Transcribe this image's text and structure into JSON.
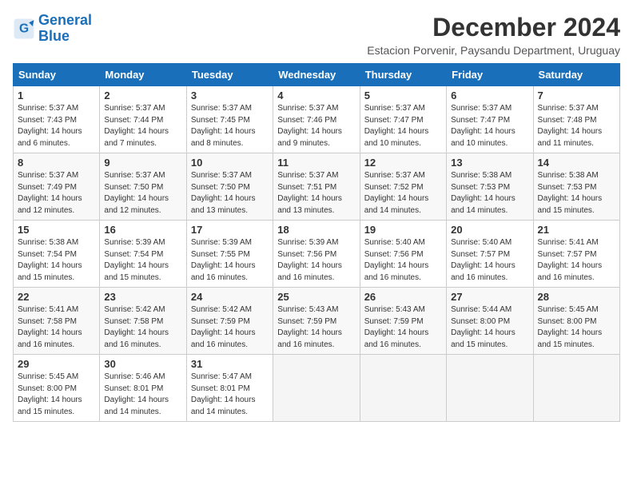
{
  "header": {
    "logo_line1": "General",
    "logo_line2": "Blue",
    "month": "December 2024",
    "location": "Estacion Porvenir, Paysandu Department, Uruguay"
  },
  "weekdays": [
    "Sunday",
    "Monday",
    "Tuesday",
    "Wednesday",
    "Thursday",
    "Friday",
    "Saturday"
  ],
  "weeks": [
    [
      {
        "day": "1",
        "sunrise": "5:37 AM",
        "sunset": "7:43 PM",
        "daylight": "14 hours and 6 minutes."
      },
      {
        "day": "2",
        "sunrise": "5:37 AM",
        "sunset": "7:44 PM",
        "daylight": "14 hours and 7 minutes."
      },
      {
        "day": "3",
        "sunrise": "5:37 AM",
        "sunset": "7:45 PM",
        "daylight": "14 hours and 8 minutes."
      },
      {
        "day": "4",
        "sunrise": "5:37 AM",
        "sunset": "7:46 PM",
        "daylight": "14 hours and 9 minutes."
      },
      {
        "day": "5",
        "sunrise": "5:37 AM",
        "sunset": "7:47 PM",
        "daylight": "14 hours and 10 minutes."
      },
      {
        "day": "6",
        "sunrise": "5:37 AM",
        "sunset": "7:47 PM",
        "daylight": "14 hours and 10 minutes."
      },
      {
        "day": "7",
        "sunrise": "5:37 AM",
        "sunset": "7:48 PM",
        "daylight": "14 hours and 11 minutes."
      }
    ],
    [
      {
        "day": "8",
        "sunrise": "5:37 AM",
        "sunset": "7:49 PM",
        "daylight": "14 hours and 12 minutes."
      },
      {
        "day": "9",
        "sunrise": "5:37 AM",
        "sunset": "7:50 PM",
        "daylight": "14 hours and 12 minutes."
      },
      {
        "day": "10",
        "sunrise": "5:37 AM",
        "sunset": "7:50 PM",
        "daylight": "14 hours and 13 minutes."
      },
      {
        "day": "11",
        "sunrise": "5:37 AM",
        "sunset": "7:51 PM",
        "daylight": "14 hours and 13 minutes."
      },
      {
        "day": "12",
        "sunrise": "5:37 AM",
        "sunset": "7:52 PM",
        "daylight": "14 hours and 14 minutes."
      },
      {
        "day": "13",
        "sunrise": "5:38 AM",
        "sunset": "7:53 PM",
        "daylight": "14 hours and 14 minutes."
      },
      {
        "day": "14",
        "sunrise": "5:38 AM",
        "sunset": "7:53 PM",
        "daylight": "14 hours and 15 minutes."
      }
    ],
    [
      {
        "day": "15",
        "sunrise": "5:38 AM",
        "sunset": "7:54 PM",
        "daylight": "14 hours and 15 minutes."
      },
      {
        "day": "16",
        "sunrise": "5:39 AM",
        "sunset": "7:54 PM",
        "daylight": "14 hours and 15 minutes."
      },
      {
        "day": "17",
        "sunrise": "5:39 AM",
        "sunset": "7:55 PM",
        "daylight": "14 hours and 16 minutes."
      },
      {
        "day": "18",
        "sunrise": "5:39 AM",
        "sunset": "7:56 PM",
        "daylight": "14 hours and 16 minutes."
      },
      {
        "day": "19",
        "sunrise": "5:40 AM",
        "sunset": "7:56 PM",
        "daylight": "14 hours and 16 minutes."
      },
      {
        "day": "20",
        "sunrise": "5:40 AM",
        "sunset": "7:57 PM",
        "daylight": "14 hours and 16 minutes."
      },
      {
        "day": "21",
        "sunrise": "5:41 AM",
        "sunset": "7:57 PM",
        "daylight": "14 hours and 16 minutes."
      }
    ],
    [
      {
        "day": "22",
        "sunrise": "5:41 AM",
        "sunset": "7:58 PM",
        "daylight": "14 hours and 16 minutes."
      },
      {
        "day": "23",
        "sunrise": "5:42 AM",
        "sunset": "7:58 PM",
        "daylight": "14 hours and 16 minutes."
      },
      {
        "day": "24",
        "sunrise": "5:42 AM",
        "sunset": "7:59 PM",
        "daylight": "14 hours and 16 minutes."
      },
      {
        "day": "25",
        "sunrise": "5:43 AM",
        "sunset": "7:59 PM",
        "daylight": "14 hours and 16 minutes."
      },
      {
        "day": "26",
        "sunrise": "5:43 AM",
        "sunset": "7:59 PM",
        "daylight": "14 hours and 16 minutes."
      },
      {
        "day": "27",
        "sunrise": "5:44 AM",
        "sunset": "8:00 PM",
        "daylight": "14 hours and 15 minutes."
      },
      {
        "day": "28",
        "sunrise": "5:45 AM",
        "sunset": "8:00 PM",
        "daylight": "14 hours and 15 minutes."
      }
    ],
    [
      {
        "day": "29",
        "sunrise": "5:45 AM",
        "sunset": "8:00 PM",
        "daylight": "14 hours and 15 minutes."
      },
      {
        "day": "30",
        "sunrise": "5:46 AM",
        "sunset": "8:01 PM",
        "daylight": "14 hours and 14 minutes."
      },
      {
        "day": "31",
        "sunrise": "5:47 AM",
        "sunset": "8:01 PM",
        "daylight": "14 hours and 14 minutes."
      },
      null,
      null,
      null,
      null
    ]
  ]
}
